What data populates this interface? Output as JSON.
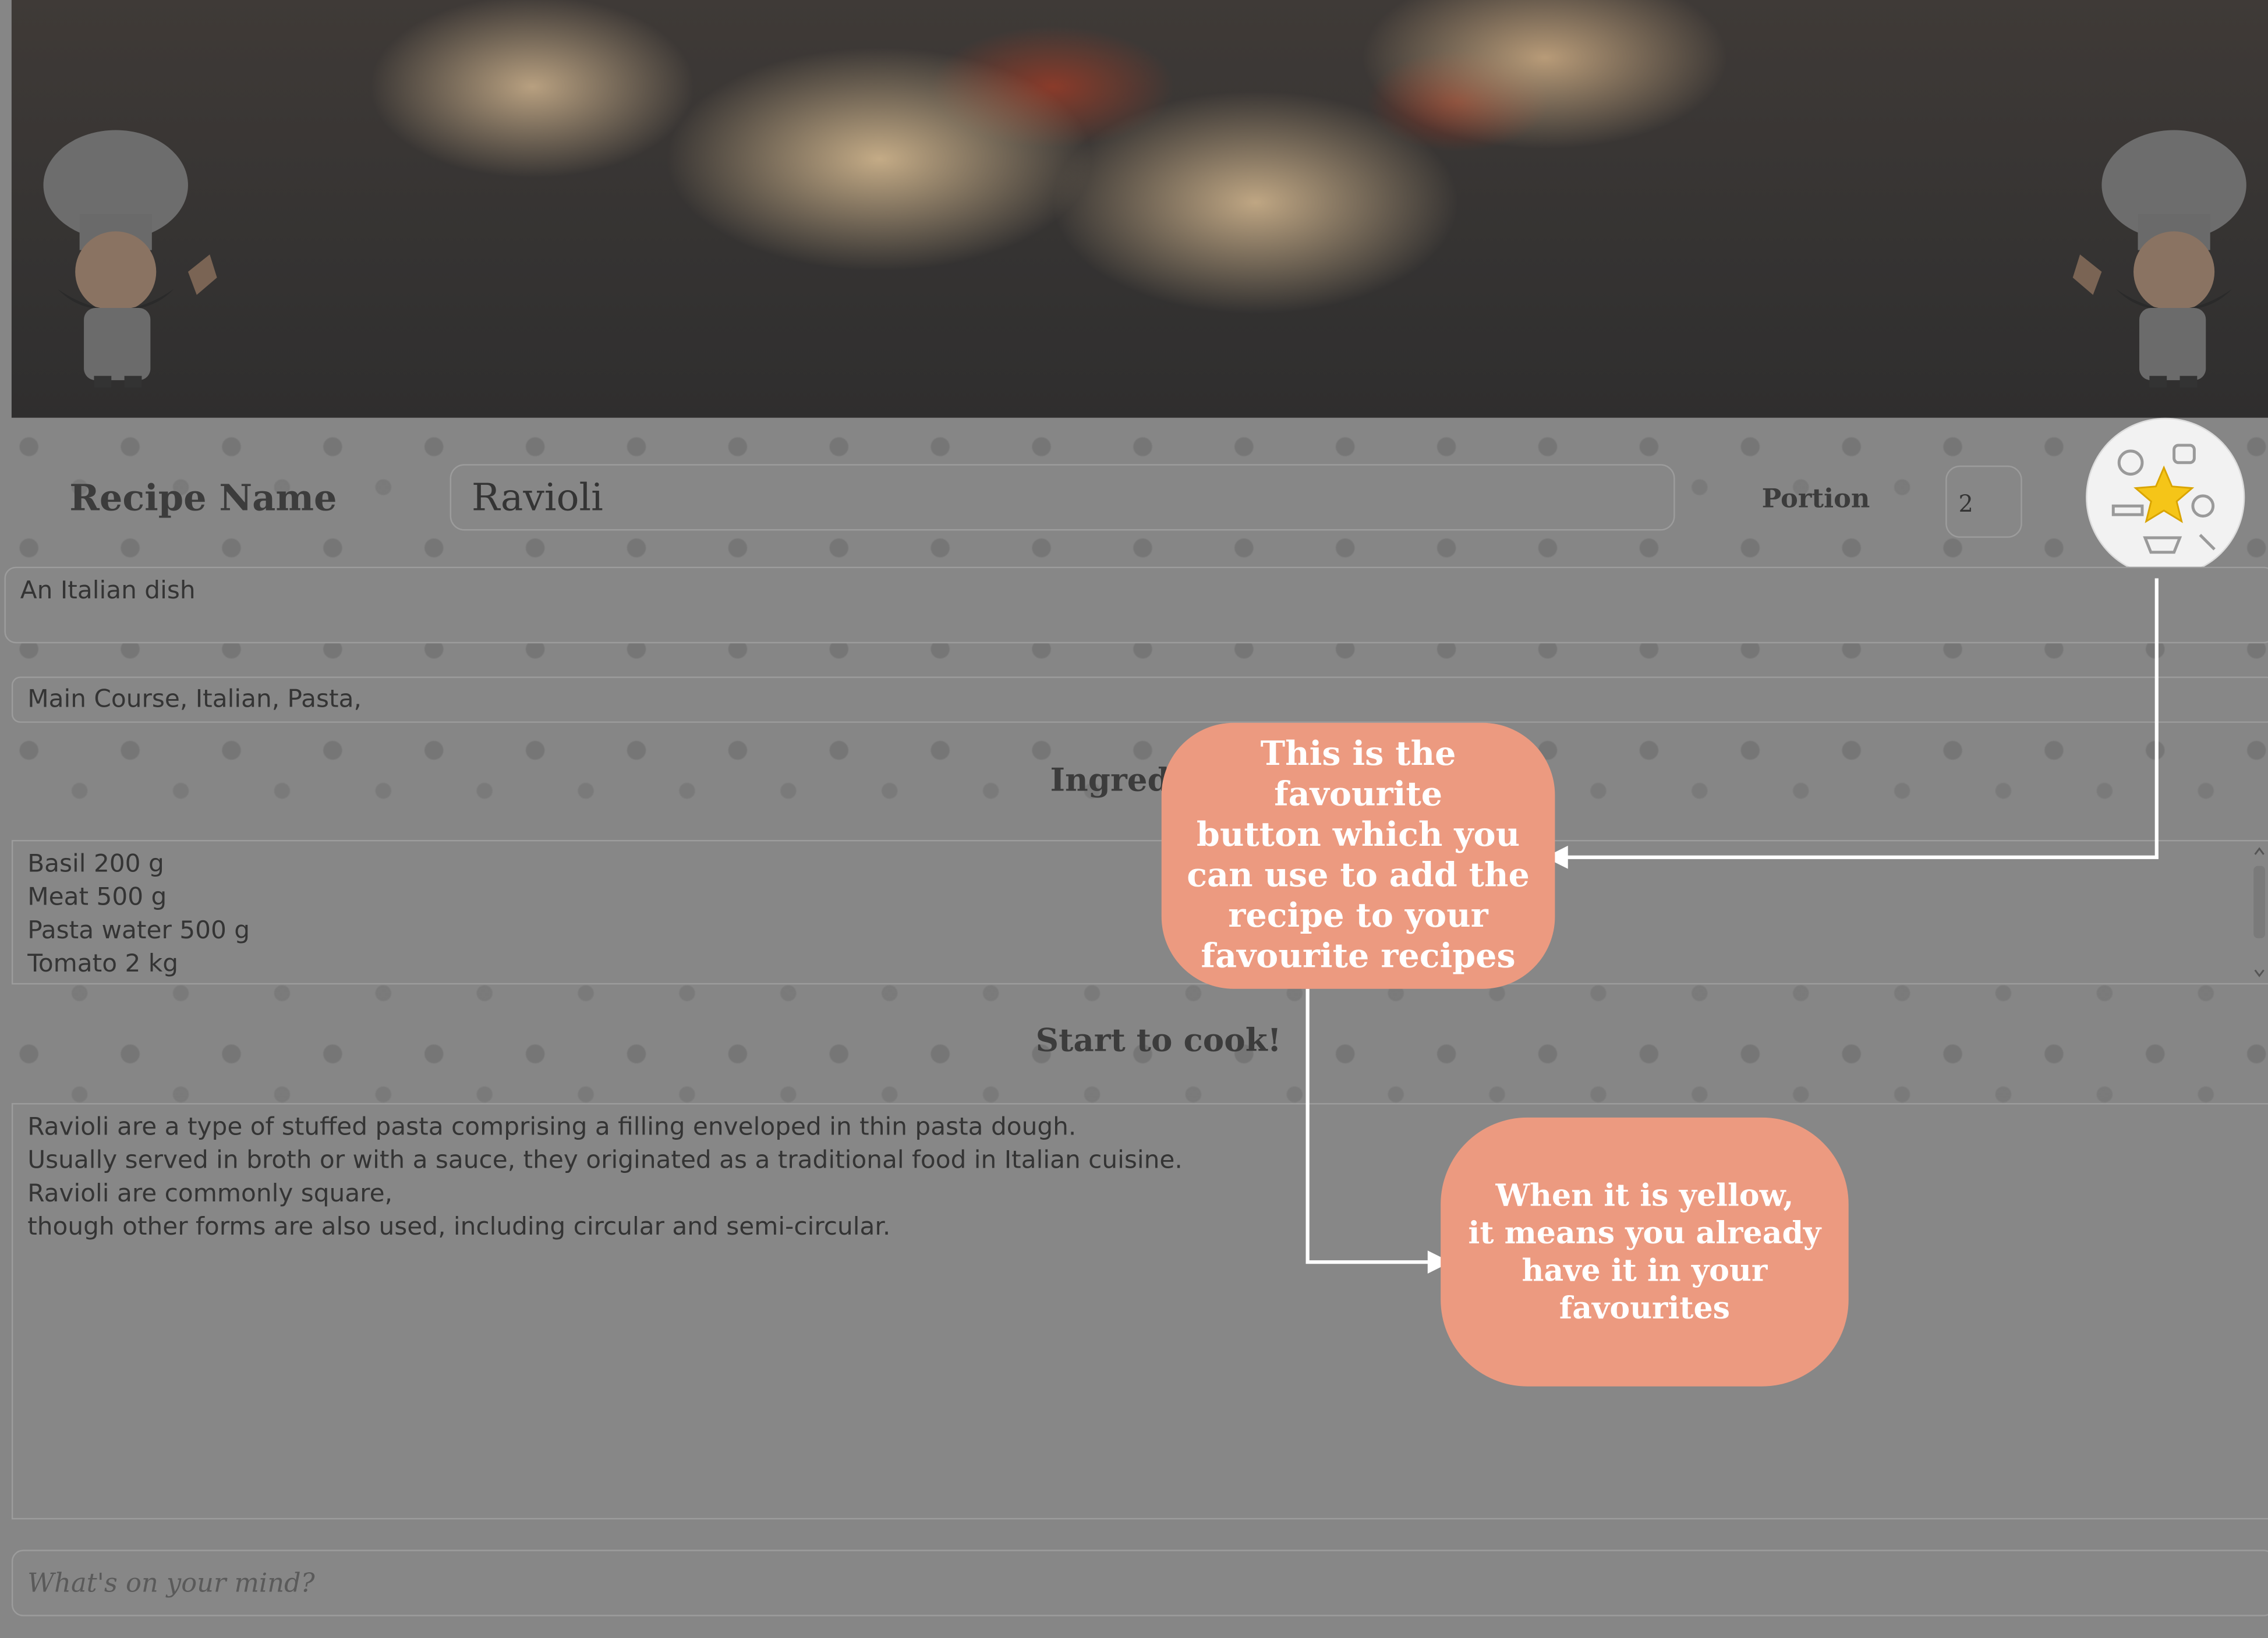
{
  "recipe": {
    "name_label": "Recipe Name",
    "name_value": "Ravioli",
    "portion_label": "Portion",
    "portion_value": "2",
    "description": "An Italian dish",
    "tags": "Main Course,  Italian,  Pasta,",
    "ingredients_heading": "Ingredi",
    "ingredients": [
      "Basil 200 g",
      "Meat 500 g",
      "Pasta water 500 g",
      "Tomato 2 kg"
    ],
    "cook_heading": "Start to cook!",
    "instructions": [
      "Ravioli are a type of stuffed pasta comprising a filling enveloped in thin pasta dough.",
      "Usually served in broth or with a sauce, they originated as a traditional food in Italian cuisine.",
      "Ravioli are commonly square,",
      "though other forms are also used, including circular and semi-circular."
    ],
    "favourite": {
      "icon": "star-icon",
      "state": "yellow",
      "color": "#f5c518"
    }
  },
  "comment": {
    "placeholder": "What's on your mind?"
  },
  "callouts": {
    "favourite_button": "This is the favourite\nbutton which you\ncan use to add the\nrecipe to your\nfavourite recipes",
    "yellow_meaning": "When it is yellow,\nit means you already\nhave it in your\nfavourites"
  },
  "colors": {
    "callout_bg": "#ec9a80",
    "overlay": "#868686",
    "star": "#f5c518"
  }
}
